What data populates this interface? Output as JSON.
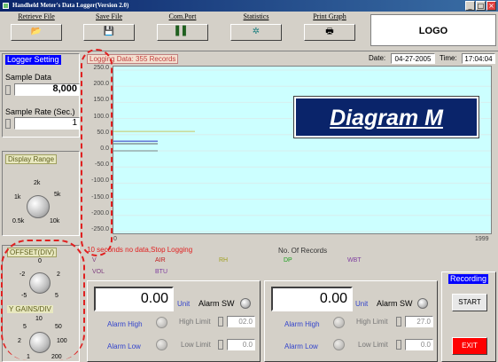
{
  "window": {
    "title": "Handheld Meter's Data Logger(Version 2.0)",
    "min": "_",
    "max": "□",
    "close": "×"
  },
  "toolbar": {
    "items": [
      {
        "label": "Retrieve File",
        "icon": "folder-open-icon",
        "glyph": "📂"
      },
      {
        "label": "Save File",
        "icon": "floppy-disk-icon",
        "glyph": "💾"
      },
      {
        "label": "Com.Port",
        "icon": "port-icon",
        "glyph": "▌▌"
      },
      {
        "label": "Statistics",
        "icon": "statistics-icon",
        "glyph": "✲"
      },
      {
        "label": "Print Graph",
        "icon": "printer-icon",
        "glyph": "🖶"
      }
    ],
    "logo": "LOGO"
  },
  "logger_setting": {
    "title": "Logger Setting",
    "sample_data_label": "Sample Data",
    "sample_data_value": "8,000",
    "sample_rate_label": "Sample Rate (Sec.)",
    "sample_rate_value": "1"
  },
  "display_range": {
    "title": "Display Range",
    "ticks": [
      "2k",
      "5k",
      "1k",
      "10k",
      "0.5k"
    ]
  },
  "offset": {
    "title": "OFFSET(DIV)",
    "ticks": [
      "0",
      "-2",
      "2",
      "-5",
      "5"
    ]
  },
  "gains": {
    "title": "Y GAINS/DIV",
    "ticks": [
      "10",
      "5",
      "50",
      "2",
      "100",
      "1",
      "200"
    ]
  },
  "chart_header": {
    "title": "Logging Data: 355 Records",
    "date_label": "Date:",
    "date": "04-27-2005",
    "time_label": "Time:",
    "time": "17:04:04"
  },
  "chart_data": {
    "type": "line",
    "y_ticks": [
      "250.0",
      "200.0",
      "150.0",
      "100.0",
      "50.0",
      "0.0",
      "-50.0",
      "-100.0",
      "-150.0",
      "-200.0",
      "-250.0"
    ],
    "x_ticks": [
      "0",
      "1999"
    ],
    "ylim": [
      -250,
      250
    ],
    "xlim": [
      0,
      1999
    ],
    "series": [
      {
        "color": "#c8c860",
        "values": [
          60,
          60
        ]
      },
      {
        "color": "#3030c0",
        "values": [
          30,
          30
        ]
      },
      {
        "color": "#606060",
        "values": [
          22,
          22
        ]
      },
      {
        "color": "#808080",
        "values": [
          0,
          0
        ]
      }
    ],
    "xlabel": "No. Of Records",
    "grid": true
  },
  "overlay": {
    "text": "Diagram M"
  },
  "status": {
    "message": "10 seconds no data,Stop Logging"
  },
  "legend": {
    "row1": [
      {
        "text": "V",
        "color": "#804080"
      },
      {
        "text": "AIR",
        "color": "#c02020"
      },
      {
        "text": "RH",
        "color": "#a0a020"
      },
      {
        "text": "DP",
        "color": "#20a020"
      },
      {
        "text": "WBT",
        "color": "#8040a0"
      }
    ],
    "row2": [
      {
        "text": "VOL",
        "color": "#804080"
      },
      {
        "text": "BTU",
        "color": "#8040a0"
      }
    ]
  },
  "meter1": {
    "value": "0.00",
    "unit": "Unit",
    "alarm_sw": "Alarm SW",
    "alarm_high": "Alarm High",
    "alarm_low": "Alarm Low",
    "high_limit_label": "High Limit",
    "high_limit": "02.0",
    "low_limit_label": "Low Limit",
    "low_limit": "0.0"
  },
  "meter2": {
    "value": "0.00",
    "unit": "Unit",
    "alarm_sw": "Alarm SW",
    "alarm_high": "Alarm High",
    "alarm_low": "Alarm Low",
    "high_limit_label": "High Limit",
    "high_limit": "27.0",
    "low_limit_label": "Low Limit",
    "low_limit": "0.0"
  },
  "recording": {
    "title": "Recording",
    "start": "START",
    "exit": "EXIT"
  },
  "colors": {
    "plot_bg": "#ccffff",
    "accent_blue": "#0000ff",
    "exit_red": "#ff0000",
    "annotation_red": "#e02020"
  }
}
